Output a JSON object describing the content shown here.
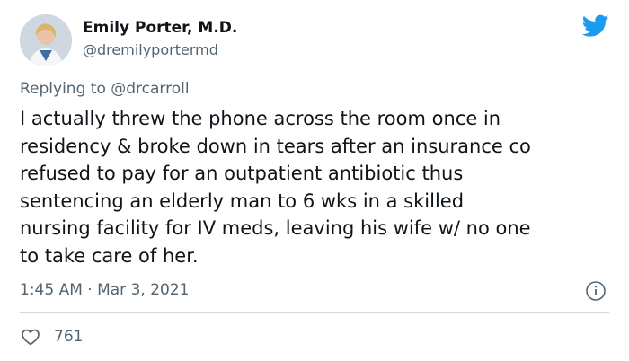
{
  "author": {
    "name": "Emily Porter, M.D.",
    "handle": "@dremilyportermd"
  },
  "reply": {
    "prefix": "Replying to",
    "mention": "@drcarroll"
  },
  "tweet": {
    "lines": [
      "I actually threw the phone across the room once in",
      "residency & broke down in tears after an insurance co",
      "refused to pay for an outpatient antibiotic thus",
      "sentencing an elderly man to 6 wks in a skilled",
      "nursing facility for IV meds, leaving his wife w/ no one",
      "to take care of her."
    ],
    "timestamp": "1:45 AM · Mar 3, 2021",
    "like_count": "761"
  },
  "icons": {
    "brand": "twitter-bird-icon",
    "info": "info-icon",
    "like": "heart-icon"
  },
  "colors": {
    "brand": "#1d9bf0",
    "text": "#0f1419",
    "secondary": "#536471",
    "divider": "#cfd9de"
  }
}
